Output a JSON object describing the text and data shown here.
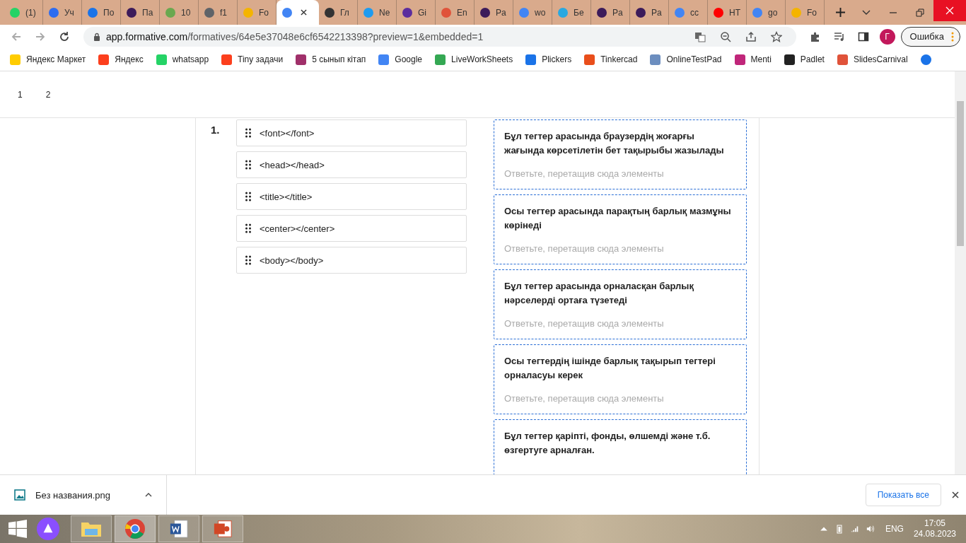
{
  "tabs": [
    {
      "title": "(1)",
      "color": "#25d366",
      "selected": false
    },
    {
      "title": "Уч",
      "color": "#2d6cf0",
      "selected": false
    },
    {
      "title": "По",
      "color": "#1a73e8",
      "selected": false
    },
    {
      "title": "Па",
      "color": "#3c1b5a",
      "selected": false
    },
    {
      "title": "10",
      "color": "#6aa84f",
      "selected": false
    },
    {
      "title": "f1",
      "color": "#5f6368",
      "selected": false
    },
    {
      "title": "Fo",
      "color": "#f4b400",
      "selected": false
    },
    {
      "color": "#4285f4",
      "selected": true
    },
    {
      "title": "Гл",
      "color": "#333333",
      "selected": false
    },
    {
      "title": "Ne",
      "color": "#1e9bf0",
      "selected": false
    },
    {
      "title": "Gi",
      "color": "#5b2d9e",
      "selected": false
    },
    {
      "title": "En",
      "color": "#e0533a",
      "selected": false
    },
    {
      "title": "Pa",
      "color": "#3c1b5a",
      "selected": false
    },
    {
      "title": "wo",
      "color": "#4285f4",
      "selected": false
    },
    {
      "title": "Бе",
      "color": "#29a8e0",
      "selected": false
    },
    {
      "title": "Pa",
      "color": "#3c1b5a",
      "selected": false
    },
    {
      "title": "Pa",
      "color": "#3c1b5a",
      "selected": false
    },
    {
      "title": "cc",
      "color": "#4285f4",
      "selected": false
    },
    {
      "title": "НТ",
      "color": "#ff0000",
      "selected": false
    },
    {
      "title": "go",
      "color": "#4285f4",
      "selected": false
    },
    {
      "title": "Fo",
      "color": "#f4b400",
      "selected": false
    }
  ],
  "address": {
    "host": "app.formative.com",
    "path": "/formatives/64e5e37048e6cf6542213398?preview=1&embedded=1"
  },
  "profile": {
    "initial": "Г",
    "status": "Ошибка"
  },
  "bookmarks": [
    {
      "label": "Яндекс Маркет",
      "color": "#ffcc00"
    },
    {
      "label": "Яндекс",
      "color": "#fc3f1d"
    },
    {
      "label": "whatsapp",
      "color": "#25d366"
    },
    {
      "label": "Tiny задачи",
      "color": "#fc3f1d"
    },
    {
      "label": "5 сынып кітап",
      "color": "#a0306a"
    },
    {
      "label": "Google",
      "color": "#4285f4"
    },
    {
      "label": "LiveWorkSheets",
      "color": "#34a853"
    },
    {
      "label": "Plickers",
      "color": "#1a73e8"
    },
    {
      "label": "Tinkercad",
      "color": "#e94e1b"
    },
    {
      "label": "OnlineTestPad",
      "color": "#6c8ebf"
    },
    {
      "label": "Menti",
      "color": "#c0267a"
    },
    {
      "label": "Padlet",
      "color": "#222222"
    },
    {
      "label": "SlidesCarnival",
      "color": "#e0533a"
    }
  ],
  "pager": [
    {
      "label": "1"
    },
    {
      "label": "2"
    }
  ],
  "question": {
    "number": "1.",
    "items": [
      "<font></font>",
      "<head></head>",
      "<title></title>",
      "<center></center>",
      "<body></body>"
    ],
    "targets": [
      {
        "prompt": "Бұл тегтер арасында браузердің жоғарғы жағында көрсетілетін бет тақырыбы жазылады",
        "placeholder": "Ответьте, перетащив сюда элементы"
      },
      {
        "prompt": "Осы тегтер арасында парақтың барлық мазмұны көрінеді",
        "placeholder": "Ответьте, перетащив сюда элементы"
      },
      {
        "prompt": "Бұл тегтер арасында орналасқан барлық нәрселерді ортаға түзетеді",
        "placeholder": "Ответьте, перетащив сюда элементы"
      },
      {
        "prompt": "Осы тегтердің ішінде барлық тақырып тегтері орналасуы керек",
        "placeholder": "Ответьте, перетащив сюда элементы"
      },
      {
        "prompt": "Бұл тегтер қаріпті, фонды, өлшемді және т.б. өзгертуге арналған."
      }
    ]
  },
  "download": {
    "filename": "Без названия.png",
    "show_all": "Показать все"
  },
  "taskbar": {
    "language": "ENG",
    "time": "17:05",
    "date": "24.08.2023"
  }
}
